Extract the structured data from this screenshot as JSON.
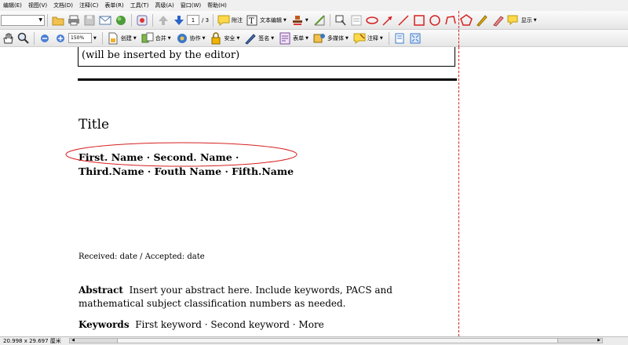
{
  "menu": [
    "编辑(E)",
    "视图(V)",
    "文档(D)",
    "注释(C)",
    "表单(R)",
    "工具(T)",
    "高级(A)",
    "窗口(W)",
    "帮助(H)"
  ],
  "toolbar1": {
    "page_current": "1",
    "page_total": "/ 3",
    "attach_label": "附注",
    "text_edit_label": "文本编辑",
    "show_label": "显示"
  },
  "toolbar2": {
    "zoom": "150%",
    "create_label": "创建",
    "combine_label": "合并",
    "collaborate_label": "协作",
    "secure_label": "安全",
    "sign_label": "签名",
    "forms_label": "表单",
    "multimedia_label": "多媒体",
    "comment_label": "注释"
  },
  "document": {
    "editor_note": "(will be inserted by the editor)",
    "title": "Title",
    "authors_line1": "First. Name · Second. Name ·",
    "authors_line2": "Third.Name · Fouth Name · Fifth.Name",
    "received": "Received: date / Accepted: date",
    "abstract_heading": "Abstract",
    "abstract_text": "Insert your abstract here. Include keywords, PACS and mathematical subject classification numbers as needed.",
    "keywords_heading": "Keywords",
    "keywords_text": "First keyword · Second keyword · More"
  },
  "status": {
    "page_size": "20.998 x 29.697 厘米"
  },
  "colors": {
    "annotation_red": "#d62020",
    "accent_blue": "#2a64c8"
  }
}
